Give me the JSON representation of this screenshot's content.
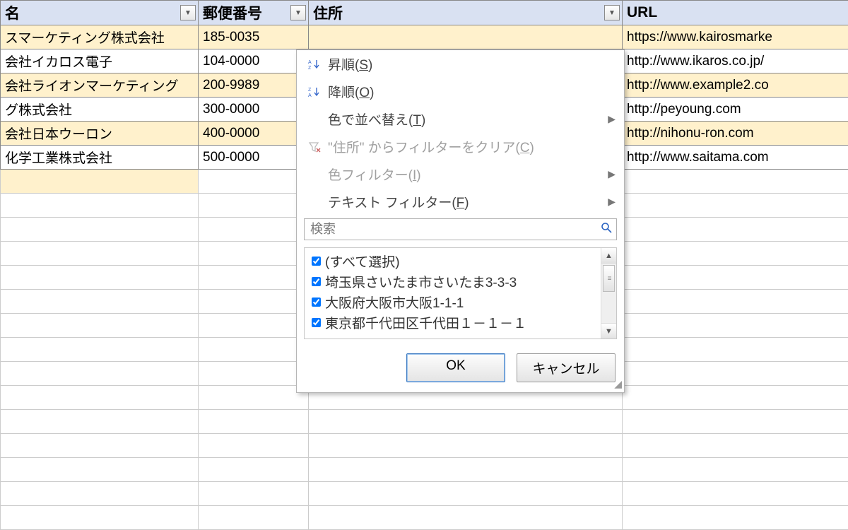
{
  "headers": {
    "name": "名",
    "postal": "郵便番号",
    "address": "住所",
    "url": "URL"
  },
  "rows": [
    {
      "name": "スマーケティング株式会社",
      "postal": "185-0035",
      "url": "https://www.kairosmarke"
    },
    {
      "name": "会社イカロス電子",
      "postal": "104-0000",
      "url": "http://www.ikaros.co.jp/"
    },
    {
      "name": "会社ライオンマーケティング",
      "postal": "200-9989",
      "url": "http://www.example2.co"
    },
    {
      "name": "グ株式会社",
      "postal": "300-0000",
      "url": "http://peyoung.com"
    },
    {
      "name": "会社日本ウーロン",
      "postal": "400-0000",
      "url": "http://nihonu-ron.com"
    },
    {
      "name": "化学工業株式会社",
      "postal": "500-0000",
      "url": "http://www.saitama.com"
    }
  ],
  "menu": {
    "sort_asc_prefix": "昇順(",
    "sort_asc_hot": "S",
    "sort_desc_prefix": "降順(",
    "sort_desc_hot": "O",
    "sort_by_color_prefix": "色で並べ替え(",
    "sort_by_color_hot": "T",
    "clear_filter_prefix": "\"住所\" からフィルターをクリア(",
    "clear_filter_hot": "C",
    "color_filter_prefix": "色フィルター(",
    "color_filter_hot": "I",
    "text_filter_prefix": "テキスト フィルター(",
    "text_filter_hot": "F",
    "close_paren": ")"
  },
  "search_placeholder": "検索",
  "check_items": {
    "all": "(すべて選択)",
    "i0": "埼玉県さいたま市さいたま3-3-3",
    "i1": "大阪府大阪市大阪1-1-1",
    "i2": "東京都千代田区千代田１－１－１"
  },
  "buttons": {
    "ok": "OK",
    "cancel": "キャンセル"
  }
}
